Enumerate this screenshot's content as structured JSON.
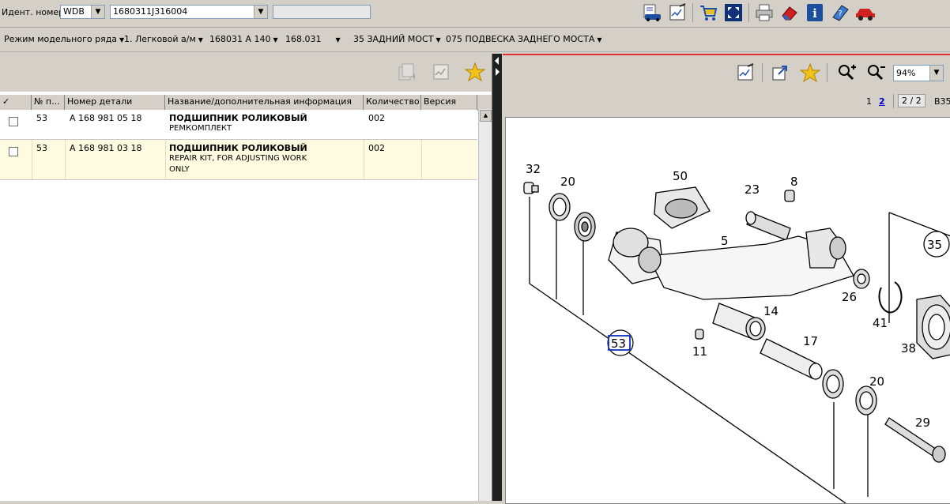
{
  "top": {
    "ident_label": "Идент. номер",
    "ident_prefix": "WDB",
    "ident_number": "1680311J316004",
    "extra_field": ""
  },
  "nav": {
    "items": [
      "Режим модельного ряда",
      "1. Легковой а/м",
      "168031 A 140",
      "168.031",
      "35 ЗАДНИЙ МОСТ",
      "075 ПОДВЕСКА ЗАДНЕГО МОСТА"
    ]
  },
  "grid": {
    "headers": [
      "✓",
      "№ п...",
      "Номер детали",
      "Название/дополнительная информация",
      "Количество",
      "Версия"
    ],
    "rows": [
      {
        "pos": "53",
        "part": "A 168 981 05 18",
        "name": "ПОДШИПНИК РОЛИКОВЫЙ",
        "info1": "РЕМКОМПЛЕКТ",
        "info2": "",
        "qty": "002",
        "version": ""
      },
      {
        "pos": "53",
        "part": "A 168 981 03 18",
        "name": "ПОДШИПНИК РОЛИКОВЫЙ",
        "info1": "REPAIR KIT, FOR ADJUSTING WORK",
        "info2": "ONLY",
        "qty": "002",
        "version": ""
      }
    ]
  },
  "viewer": {
    "zoom": "94%",
    "page1": "1",
    "page2": "2",
    "page_of": "2 / 2",
    "code": "B35"
  },
  "diagram": {
    "labels": [
      "32",
      "20",
      "50",
      "23",
      "8",
      "5",
      "35",
      "26",
      "41",
      "14",
      "38",
      "53",
      "11",
      "17",
      "20",
      "29"
    ]
  },
  "colors": {
    "accent_red": "#e03030",
    "row_highlight": "#fffbe0",
    "link_blue": "#0000cc"
  }
}
